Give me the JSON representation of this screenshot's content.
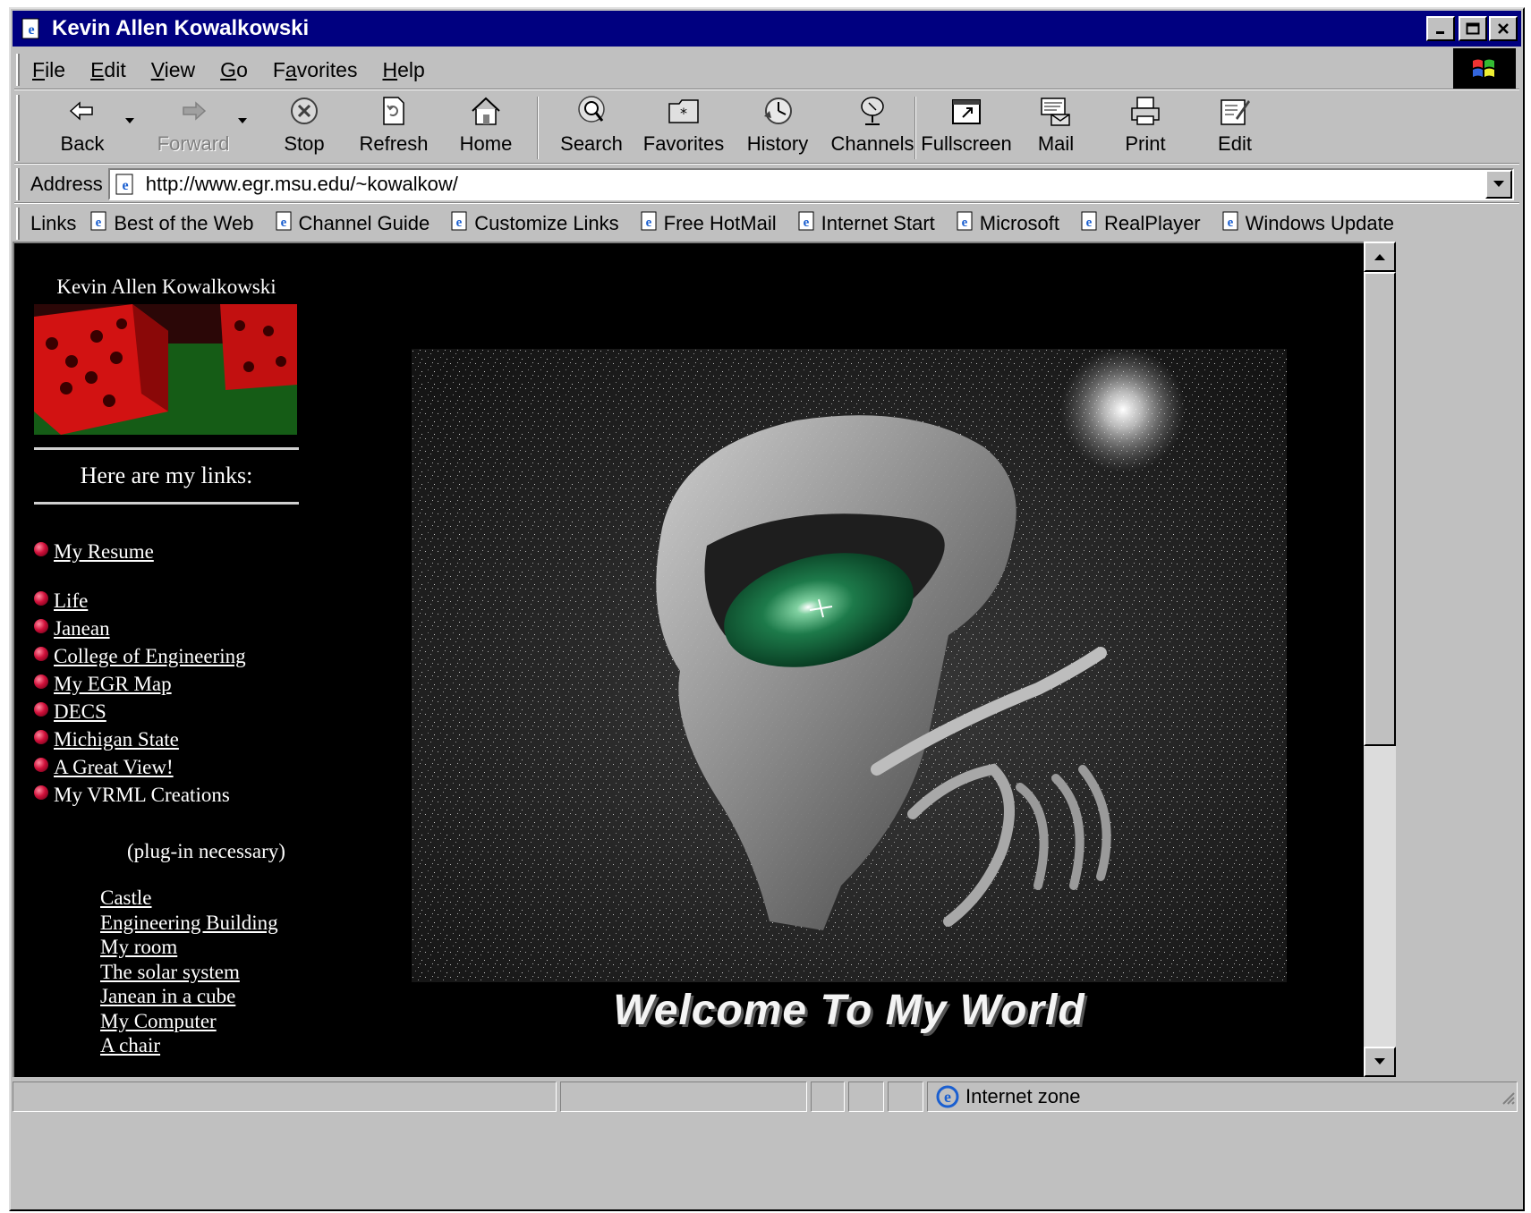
{
  "window": {
    "title": "Kevin Allen Kowalkowski",
    "controls": [
      "minimize",
      "maximize",
      "close"
    ]
  },
  "menu": [
    {
      "label": "File",
      "accel": "F"
    },
    {
      "label": "Edit",
      "accel": "E"
    },
    {
      "label": "View",
      "accel": "V"
    },
    {
      "label": "Go",
      "accel": "G"
    },
    {
      "label": "Favorites",
      "accel": "a"
    },
    {
      "label": "Help",
      "accel": "H"
    }
  ],
  "toolbar": {
    "back": "Back",
    "forward": "Forward",
    "stop": "Stop",
    "refresh": "Refresh",
    "home": "Home",
    "search": "Search",
    "favorites": "Favorites",
    "history": "History",
    "channels": "Channels",
    "fullscreen": "Fullscreen",
    "mail": "Mail",
    "print": "Print",
    "edit": "Edit"
  },
  "address": {
    "label": "Address",
    "url": "http://www.egr.msu.edu/~kowalkow/"
  },
  "links_bar": {
    "label": "Links",
    "items": [
      "Best of the Web",
      "Channel Guide",
      "Customize Links",
      "Free HotMail",
      "Internet Start",
      "Microsoft",
      "RealPlayer",
      "Windows Update"
    ]
  },
  "page": {
    "name": "Kevin Allen Kowalkowski",
    "links_heading": "Here are my links:",
    "links": [
      "My Resume",
      "Life",
      "Janean",
      "College of Engineering",
      "My EGR Map",
      "DECS",
      "Michigan State",
      "A Great View!"
    ],
    "vrml_heading": "My VRML Creations",
    "plugin_note": "(plug-in necessary)",
    "vrml_links": [
      "Castle",
      "Engineering Building",
      "My room",
      "The solar system",
      "Janean in a cube",
      "My Computer",
      "A chair"
    ],
    "welcome": "Welcome To My World"
  },
  "status": {
    "zone": "Internet zone"
  }
}
